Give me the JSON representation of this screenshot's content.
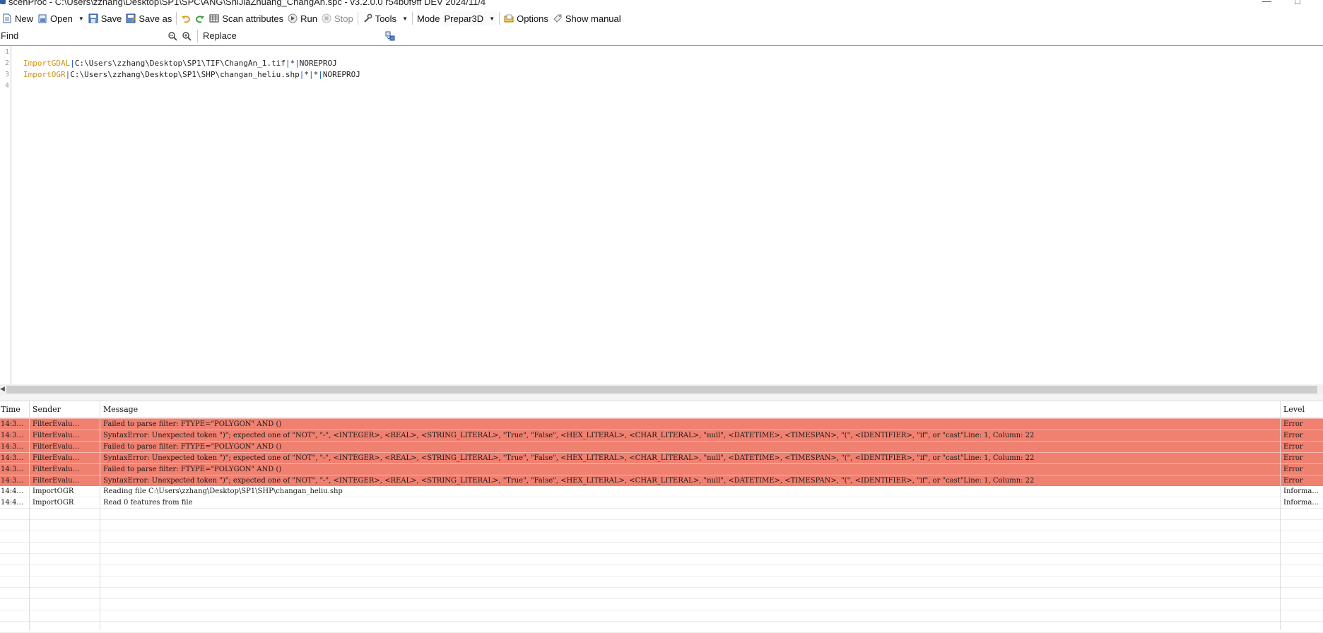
{
  "window": {
    "title": "scenProc - C:\\Users\\zzhang\\Desktop\\SP1\\SPC\\ANG\\ShiJiaZhuang_ChangAn.spc - v3.2.0.0 r54b0f9ff DEV 2024/11/4",
    "minimize_glyph": "—",
    "maximize_glyph": "□"
  },
  "toolbar": {
    "new_label": "New",
    "open_label": "Open",
    "save_label": "Save",
    "save_as_label": "Save as",
    "scan_attributes_label": "Scan attributes",
    "run_label": "Run",
    "stop_label": "Stop",
    "tools_label": "Tools",
    "mode_label": "Mode",
    "mode_value": "Prepar3D",
    "options_label": "Options",
    "show_manual_label": "Show manual",
    "dropdown_glyph": "▼",
    "icons": {
      "new": "new-document-icon",
      "open": "open-folder-icon",
      "save": "save-disk-icon",
      "save_as": "save-as-disk-icon",
      "undo": "undo-icon",
      "redo": "redo-icon",
      "scan": "scan-attributes-icon",
      "run": "run-icon",
      "stop": "stop-icon",
      "tools": "tools-wrench-icon",
      "options": "options-folder-icon",
      "manual": "manual-tag-icon"
    }
  },
  "findbar": {
    "find_placeholder": "Find",
    "replace_placeholder": "Replace",
    "icons": [
      "find-previous-icon",
      "find-next-icon",
      "replace-all-icon"
    ]
  },
  "editor": {
    "line_numbers": [
      "1",
      "2",
      "3",
      "4"
    ],
    "lines": [
      [],
      [
        {
          "t": "ImportGDAL",
          "k": "kw"
        },
        {
          "t": "|",
          "k": "pipe"
        },
        {
          "t": "C:\\Users\\zzhang\\Desktop\\SP1\\TIF\\ChangAn_1.tif",
          "k": "txt"
        },
        {
          "t": "|",
          "k": "pipe"
        },
        {
          "t": "*",
          "k": "txt"
        },
        {
          "t": "|",
          "k": "pipe"
        },
        {
          "t": "NOREPROJ",
          "k": "txt"
        }
      ],
      [
        {
          "t": "ImportOGR",
          "k": "kw"
        },
        {
          "t": "|",
          "k": "pipe"
        },
        {
          "t": "C:\\Users\\zzhang\\Desktop\\SP1\\SHP\\changan_heliu.shp",
          "k": "txt"
        },
        {
          "t": "|",
          "k": "pipe"
        },
        {
          "t": "*",
          "k": "txt"
        },
        {
          "t": "|",
          "k": "pipe"
        },
        {
          "t": "*",
          "k": "txt"
        },
        {
          "t": "|",
          "k": "pipe"
        },
        {
          "t": "NOREPROJ",
          "k": "txt"
        }
      ],
      []
    ]
  },
  "log": {
    "headers": {
      "time": "Time",
      "sender": "Sender",
      "message": "Message",
      "level": "Level"
    },
    "colors": {
      "error_row": "#f08070",
      "info_row": "#ffffff"
    },
    "rows": [
      {
        "time": "14:3...",
        "sender": "FilterEvalu...",
        "message": "Failed to parse filter: FTYPE=\"POLYGON\" AND ()",
        "level": "Error",
        "kind": "error"
      },
      {
        "time": "14:3...",
        "sender": "FilterEvalu...",
        "message": "SyntaxError: Unexpected token \")\"; expected one of \"NOT\", \"-\", <INTEGER>, <REAL>, <STRING_LITERAL>, \"True\", \"False\", <HEX_LITERAL>, <CHAR_LITERAL>, \"null\", <DATETIME>, <TIMESPAN>, \"(\", <IDENTIFIER>, \"if\", or \"cast\"Line: 1, Column: 22",
        "level": "Error",
        "kind": "error"
      },
      {
        "time": "14:3...",
        "sender": "FilterEvalu...",
        "message": "Failed to parse filter: FTYPE=\"POLYGON\" AND ()",
        "level": "Error",
        "kind": "error"
      },
      {
        "time": "14:3...",
        "sender": "FilterEvalu...",
        "message": "SyntaxError: Unexpected token \")\"; expected one of \"NOT\", \"-\", <INTEGER>, <REAL>, <STRING_LITERAL>, \"True\", \"False\", <HEX_LITERAL>, <CHAR_LITERAL>, \"null\", <DATETIME>, <TIMESPAN>, \"(\", <IDENTIFIER>, \"if\", or \"cast\"Line: 1, Column: 22",
        "level": "Error",
        "kind": "error"
      },
      {
        "time": "14:3...",
        "sender": "FilterEvalu...",
        "message": "Failed to parse filter: FTYPE=\"POLYGON\" AND ()",
        "level": "Error",
        "kind": "error"
      },
      {
        "time": "14:3...",
        "sender": "FilterEvalu...",
        "message": "SyntaxError: Unexpected token \")\"; expected one of \"NOT\", \"-\", <INTEGER>, <REAL>, <STRING_LITERAL>, \"True\", \"False\", <HEX_LITERAL>, <CHAR_LITERAL>, \"null\", <DATETIME>, <TIMESPAN>, \"(\", <IDENTIFIER>, \"if\", or \"cast\"Line: 1, Column: 22",
        "level": "Error",
        "kind": "error"
      },
      {
        "time": "14:4...",
        "sender": "ImportOGR",
        "message": "Reading file C:\\Users\\zzhang\\Desktop\\SP1\\SHP\\changan_heliu.shp",
        "level": "Informa...",
        "kind": "info"
      },
      {
        "time": "14:4...",
        "sender": "ImportOGR",
        "message": "Read 0 features from file",
        "level": "Informa...",
        "kind": "info"
      }
    ]
  }
}
